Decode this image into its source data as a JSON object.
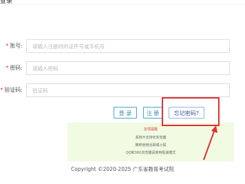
{
  "header": {
    "title": "登录"
  },
  "form": {
    "account": {
      "label": "账号:",
      "placeholder": "请输入注册时的证件号或手机号"
    },
    "password": {
      "label": "密码:",
      "placeholder": "请输入密码"
    },
    "captcha": {
      "label": "验证码:",
      "placeholder": "验证码"
    }
  },
  "buttons": {
    "login": "登 录",
    "register": "注 册",
    "forgot": "忘记密码?"
  },
  "tips": {
    "title": "友情提醒",
    "lines": [
      "系统不支持IE浏览器",
      "推荐使用谷歌或火狐",
      "QQ和360浏览器请使用极速模式"
    ]
  },
  "footer": {
    "copyright": "Copyright ©2020-2025 广东省教育考试院"
  },
  "colors": {
    "accent": "#2b87b3",
    "highlight": "#e03030",
    "tips_bg": "#f0fbe2"
  }
}
